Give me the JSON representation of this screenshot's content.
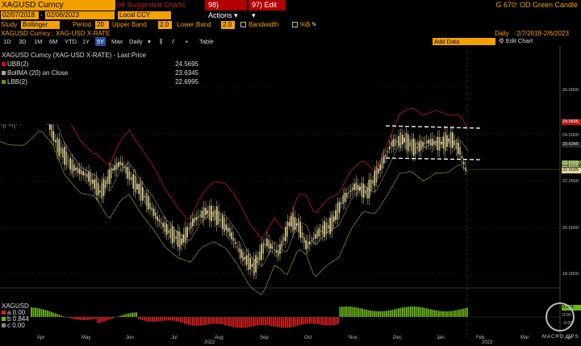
{
  "toolbar": {
    "ticker": "XAGUSD Curncy",
    "suggested": "96 Suggested Charts",
    "actions": "98) Actions",
    "edit": "97) Edit",
    "title": "G 670: OD Green Candle"
  },
  "range": {
    "start": "02/07/2018",
    "end": "02/06/2023",
    "currency": "Local CCY"
  },
  "study": {
    "label": "Study",
    "name": "Bollinger",
    "period_label": "Period",
    "period": "20",
    "upper_label": "Upper Band",
    "upper": "2.0",
    "lower_label": "Lower Band",
    "lower": "2.0",
    "bandwidth": "Bandwidth",
    "pctb": "%B"
  },
  "security": {
    "label": "XAGUSD Curncy : XAG-USD X-RATE",
    "frequency": "Daily",
    "date_range": "2/7/2018-2/6/2023"
  },
  "periods": [
    "1D",
    "3D",
    "1M",
    "6M",
    "YTD",
    "1Y",
    "5Y",
    "Max"
  ],
  "periods_selected": "5Y",
  "interval": "Daily",
  "table_label": "Table",
  "add_data": "Add Data",
  "edit_chart": "Edit Chart",
  "legend": {
    "title": "XAGUSD Curncy (XAG-USD X-RATE) - Last Price",
    "rows": [
      {
        "label": "UBB(2)",
        "value": "24.5695",
        "color": "#c01818"
      },
      {
        "label": "BollMA (20)  on Close",
        "value": "23.6345",
        "color": "#aaaaaa"
      },
      {
        "label": "LBB(2)",
        "value": "22.6995",
        "color": "#6a8e1a"
      }
    ]
  },
  "sub_legend": {
    "title": "XAGUSD",
    "rows": [
      "a 0.00",
      "b 0.844",
      "c 0.00"
    ]
  },
  "sub_tags": [
    "0.844",
    "0.00",
    "-0.00"
  ],
  "y_labels": [
    "26.0000",
    "24.0000",
    "22.0000",
    "20.0000",
    "18.0000"
  ],
  "y_tags": [
    "24.5695",
    "23.6345",
    "23.0000",
    "22.6995",
    "22.5035"
  ],
  "x_months": [
    "Apr",
    "May",
    "Jun",
    "Jul",
    "Aug",
    "Sep",
    "Oct",
    "Nov",
    "Dec",
    "Jan",
    "Feb",
    "Mar",
    "Apr"
  ],
  "x_years": [
    "2022",
    "2023"
  ],
  "watermark": "MACRO OPS",
  "colors": {
    "accent": "#f2a100",
    "red_button": "#b20000",
    "upper_band": "#c01818",
    "lower_band": "#6a8e1a",
    "ma": "#aaaaaa",
    "candle": "#e6d7a4",
    "sub_pos": "#6bb81a",
    "sub_neg": "#d42020"
  }
}
